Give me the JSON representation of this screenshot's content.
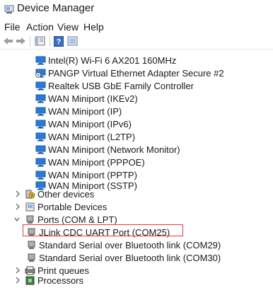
{
  "window": {
    "title": "Device Manager"
  },
  "menu": [
    "File",
    "Action",
    "View",
    "Help"
  ],
  "toolbar": [
    "back-arrow-icon",
    "forward-arrow-icon",
    "properties-icon",
    "help-icon",
    "device-view-icon"
  ],
  "network_devices": [
    "Intel(R) Wi-Fi 6 AX201 160MHz",
    "PANGP Virtual Ethernet Adapter Secure #2",
    "Realtek USB GbE Family Controller",
    "WAN Miniport (IKEv2)",
    "WAN Miniport (IP)",
    "WAN Miniport (IPv6)",
    "WAN Miniport (L2TP)",
    "WAN Miniport (Network Monitor)",
    "WAN Miniport (PPPOE)",
    "WAN Miniport (PPTP)",
    "WAN Miniport (SSTP)"
  ],
  "categories": {
    "other_devices": "Other devices",
    "portable_devices": "Portable Devices",
    "ports": "Ports (COM & LPT)",
    "print_queues": "Print queues",
    "processors": "Processors"
  },
  "ports_children": [
    "JLink CDC UART Port (COM25)",
    "Standard Serial over Bluetooth link (COM29)",
    "Standard Serial over Bluetooth link (COM30)"
  ],
  "highlighted_item": "JLink CDC UART Port (COM25)",
  "colors": {
    "highlight_border": "#e03c3c",
    "icon_blue": "#2a7bd8"
  }
}
